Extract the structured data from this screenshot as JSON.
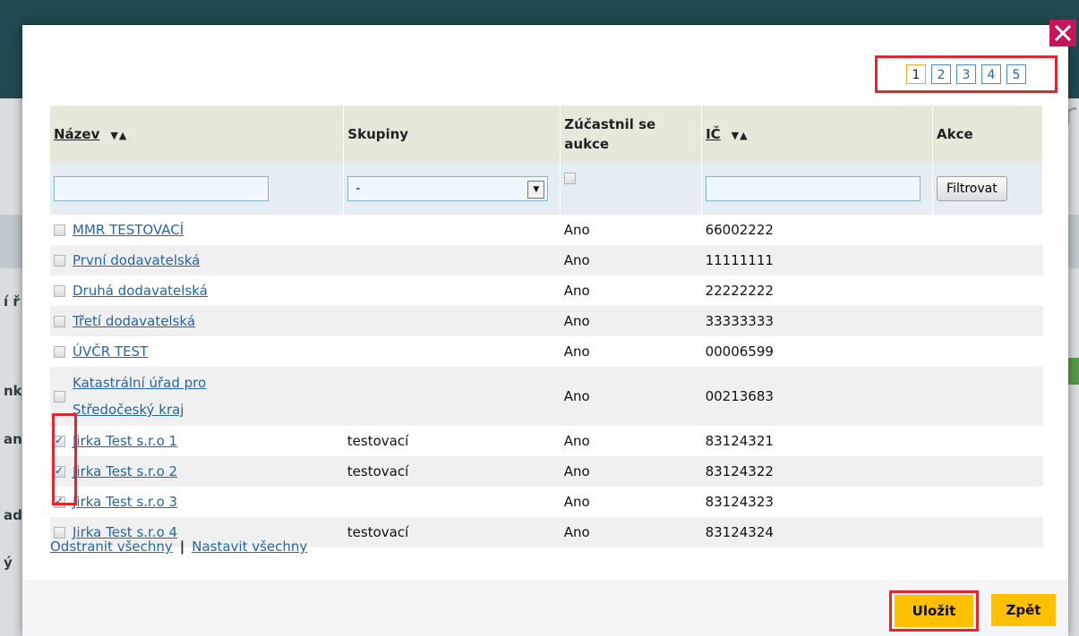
{
  "background_fragments": [
    "í ř",
    "nk",
    "an",
    "ad",
    "ý"
  ],
  "background_right_letter": "r",
  "pager": {
    "pages": [
      "1",
      "2",
      "3",
      "4",
      "5"
    ],
    "current": "1"
  },
  "table": {
    "headers": {
      "name": "Název",
      "groups": "Skupiny",
      "participated": "Zúčastnil se aukce",
      "ic": "IČ",
      "actions": "Akce"
    },
    "sort_icons": "▼▲",
    "filters": {
      "name_value": "",
      "group_selected": "-",
      "participated_checked": false,
      "ic_value": "",
      "filter_button": "Filtrovat"
    },
    "rows": [
      {
        "name": "MMR TESTOVACÍ",
        "group": "",
        "participated": "Ano",
        "ic": "66002222",
        "checked": false
      },
      {
        "name": "První dodavatelská",
        "group": "",
        "participated": "Ano",
        "ic": "11111111",
        "checked": false
      },
      {
        "name": "Druhá dodavatelská",
        "group": "",
        "participated": "Ano",
        "ic": "22222222",
        "checked": false
      },
      {
        "name": "Třetí dodavatelská",
        "group": "",
        "participated": "Ano",
        "ic": "33333333",
        "checked": false
      },
      {
        "name": "ÚVČR TEST",
        "group": "",
        "participated": "Ano",
        "ic": "00006599",
        "checked": false
      },
      {
        "name_line1": "Katastrální úřad pro",
        "name_line2": "Středočeský kraj",
        "group": "",
        "participated": "Ano",
        "ic": "00213683",
        "checked": false
      },
      {
        "name": "Jirka Test s.r.o 1",
        "group": "testovací",
        "participated": "Ano",
        "ic": "83124321",
        "checked": true
      },
      {
        "name": "Jirka Test s.r.o 2",
        "group": "testovací",
        "participated": "Ano",
        "ic": "83124322",
        "checked": true
      },
      {
        "name": "Jirka Test s.r.o 3",
        "group": "",
        "participated": "Ano",
        "ic": "83124323",
        "checked": true
      },
      {
        "name": "Jirka Test s.r.o 4",
        "group": "testovací",
        "participated": "Ano",
        "ic": "83124324",
        "checked": false
      }
    ]
  },
  "bulk": {
    "remove_all": "Odstranit všechny",
    "separator": "|",
    "set_all": "Nastavit všechny"
  },
  "buttons": {
    "save": "Uložit",
    "back": "Zpět"
  },
  "colors": {
    "accent_yellow": "#ffc000",
    "highlight_red": "#e0262f",
    "close_magenta": "#c2185b",
    "link_blue": "#2466a6"
  }
}
